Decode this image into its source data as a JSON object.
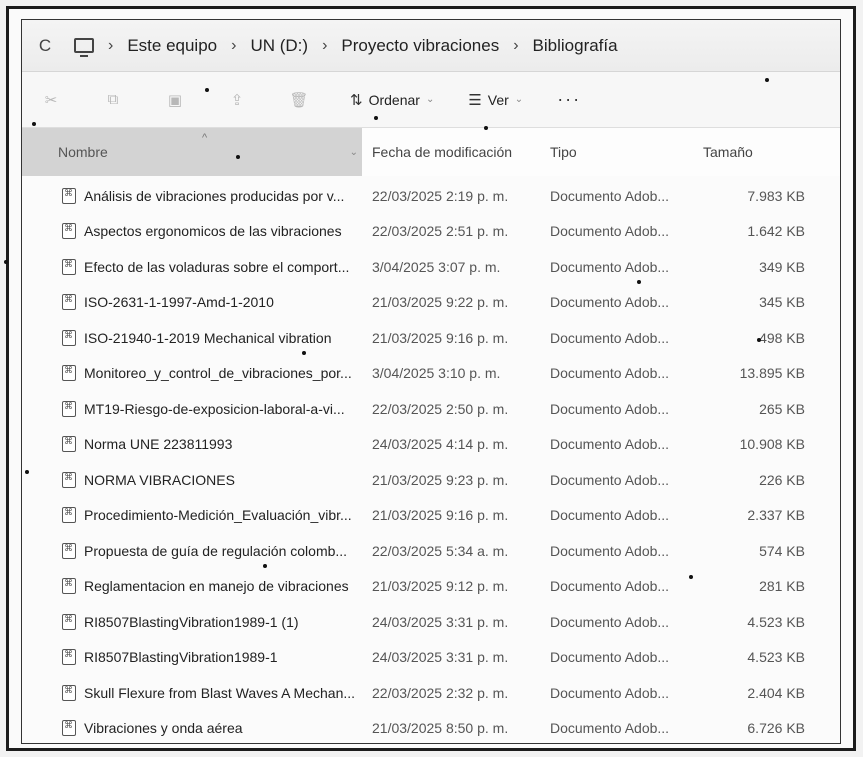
{
  "address": {
    "refresh_icon": "refresh-icon",
    "crumbs": [
      "Este equipo",
      "UN (D:)",
      "Proyecto vibraciones",
      "Bibliografía"
    ]
  },
  "toolbar": {
    "sort_label": "Ordenar",
    "view_label": "Ver",
    "more_label": "···"
  },
  "headers": {
    "name": "Nombre",
    "date": "Fecha de modificación",
    "type": "Tipo",
    "size": "Tamaño"
  },
  "files": [
    {
      "name": "Análisis de vibraciones producidas por v...",
      "date": "22/03/2025 2:19 p. m.",
      "type": "Documento Adob...",
      "size": "7.983 KB"
    },
    {
      "name": "Aspectos ergonomicos de las vibraciones",
      "date": "22/03/2025 2:51 p. m.",
      "type": "Documento Adob...",
      "size": "1.642 KB"
    },
    {
      "name": "Efecto de las voladuras sobre el comport...",
      "date": "3/04/2025 3:07 p. m.",
      "type": "Documento Adob...",
      "size": "349 KB"
    },
    {
      "name": "ISO-2631-1-1997-Amd-1-2010",
      "date": "21/03/2025 9:22 p. m.",
      "type": "Documento Adob...",
      "size": "345 KB"
    },
    {
      "name": "ISO-21940-1-2019 Mechanical vibration",
      "date": "21/03/2025 9:16 p. m.",
      "type": "Documento Adob...",
      "size": "498 KB"
    },
    {
      "name": "Monitoreo_y_control_de_vibraciones_por...",
      "date": "3/04/2025 3:10 p. m.",
      "type": "Documento Adob...",
      "size": "13.895 KB"
    },
    {
      "name": "MT19-Riesgo-de-exposicion-laboral-a-vi...",
      "date": "22/03/2025 2:50 p. m.",
      "type": "Documento Adob...",
      "size": "265 KB"
    },
    {
      "name": "Norma UNE 223811993",
      "date": "24/03/2025 4:14 p. m.",
      "type": "Documento Adob...",
      "size": "10.908 KB"
    },
    {
      "name": "NORMA VIBRACIONES",
      "date": "21/03/2025 9:23 p. m.",
      "type": "Documento Adob...",
      "size": "226 KB"
    },
    {
      "name": "Procedimiento-Medición_Evaluación_vibr...",
      "date": "21/03/2025 9:16 p. m.",
      "type": "Documento Adob...",
      "size": "2.337 KB"
    },
    {
      "name": "Propuesta de guía de regulación colomb...",
      "date": "22/03/2025 5:34 a. m.",
      "type": "Documento Adob...",
      "size": "574 KB"
    },
    {
      "name": "Reglamentacion en manejo de vibraciones",
      "date": "21/03/2025 9:12 p. m.",
      "type": "Documento Adob...",
      "size": "281 KB"
    },
    {
      "name": "RI8507BlastingVibration1989-1 (1)",
      "date": "24/03/2025 3:31 p. m.",
      "type": "Documento Adob...",
      "size": "4.523 KB"
    },
    {
      "name": "RI8507BlastingVibration1989-1",
      "date": "24/03/2025 3:31 p. m.",
      "type": "Documento Adob...",
      "size": "4.523 KB"
    },
    {
      "name": "Skull Flexure from Blast Waves A Mechan...",
      "date": "22/03/2025 2:32 p. m.",
      "type": "Documento Adob...",
      "size": "2.404 KB"
    },
    {
      "name": "Vibraciones y onda aérea",
      "date": "21/03/2025 8:50 p. m.",
      "type": "Documento Adob...",
      "size": "6.726 KB"
    }
  ]
}
